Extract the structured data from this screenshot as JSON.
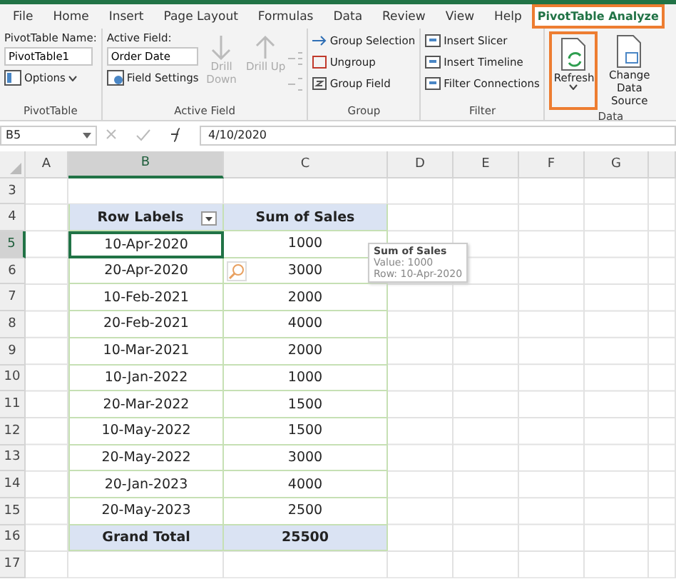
{
  "ribbon_tabs": [
    {
      "label": "File",
      "selected": false
    },
    {
      "label": "Home",
      "selected": false
    },
    {
      "label": "Insert",
      "selected": false
    },
    {
      "label": "Page Layout",
      "selected": false
    },
    {
      "label": "Formulas",
      "selected": false
    },
    {
      "label": "Data",
      "selected": false
    },
    {
      "label": "Review",
      "selected": false
    },
    {
      "label": "View",
      "selected": false
    },
    {
      "label": "Help",
      "selected": false
    },
    {
      "label": "PivotTable Analyze",
      "selected": true
    }
  ],
  "pivottable_group": {
    "name_label": "PivotTable Name:",
    "name_value": "PivotTable1",
    "options": "Options",
    "caption": "PivotTable"
  },
  "active_field_group": {
    "field_label": "Active Field:",
    "field_value": "Order Date",
    "field_settings": "Field Settings",
    "drill_down": "Drill Down",
    "drill_up": "Drill Up",
    "drill_disabled": true,
    "caption": "Active Field"
  },
  "group_group": {
    "items": [
      "Group Selection",
      "Ungroup",
      "Group Field"
    ],
    "caption": "Group"
  },
  "filter_group": {
    "items": [
      "Insert Slicer",
      "Insert Timeline",
      "Filter Connections"
    ],
    "caption": "Filter"
  },
  "data_group": {
    "refresh": "Refresh",
    "refresh_highlighted": true,
    "change_source": "Change Data Source",
    "caption": "Data"
  },
  "formula_bar": {
    "name_box": "B5",
    "value": "4/10/2020"
  },
  "columns": [
    {
      "label": "A",
      "selected": false
    },
    {
      "label": "B",
      "selected": true
    },
    {
      "label": "C",
      "selected": false
    },
    {
      "label": "D",
      "selected": false
    },
    {
      "label": "E",
      "selected": false
    },
    {
      "label": "F",
      "selected": false
    },
    {
      "label": "G",
      "selected": false
    }
  ],
  "pivot": {
    "headers": [
      "Row Labels",
      "Sum of Sales"
    ],
    "rows": [
      {
        "row": "3",
        "kind": "empty",
        "selected": false
      },
      {
        "row": "4",
        "kind": "header",
        "selected": false
      },
      {
        "row": "5",
        "kind": "data",
        "label": "10-Apr-2020",
        "value": "1000",
        "selected": true
      },
      {
        "row": "6",
        "kind": "data",
        "label": "20-Apr-2020",
        "value": "3000",
        "selected": false
      },
      {
        "row": "7",
        "kind": "data",
        "label": "10-Feb-2021",
        "value": "2000",
        "selected": false
      },
      {
        "row": "8",
        "kind": "data",
        "label": "20-Feb-2021",
        "value": "4000",
        "selected": false
      },
      {
        "row": "9",
        "kind": "data",
        "label": "10-Mar-2021",
        "value": "2000",
        "selected": false
      },
      {
        "row": "10",
        "kind": "data",
        "label": "10-Jan-2022",
        "value": "1000",
        "selected": false
      },
      {
        "row": "11",
        "kind": "data",
        "label": "20-Mar-2022",
        "value": "1500",
        "selected": false
      },
      {
        "row": "12",
        "kind": "data",
        "label": "10-May-2022",
        "value": "1500",
        "selected": false
      },
      {
        "row": "13",
        "kind": "data",
        "label": "20-May-2022",
        "value": "3000",
        "selected": false
      },
      {
        "row": "14",
        "kind": "data",
        "label": "20-Jan-2023",
        "value": "4000",
        "selected": false
      },
      {
        "row": "15",
        "kind": "data",
        "label": "20-May-2023",
        "value": "2500",
        "selected": false
      },
      {
        "row": "16",
        "kind": "total",
        "label": "Grand Total",
        "value": "25500",
        "selected": false
      },
      {
        "row": "17",
        "kind": "empty",
        "selected": false
      }
    ]
  },
  "tooltip": {
    "title": "Sum of Sales",
    "lines": [
      "Value: 1000",
      "Row: 10-Apr-2020"
    ]
  }
}
